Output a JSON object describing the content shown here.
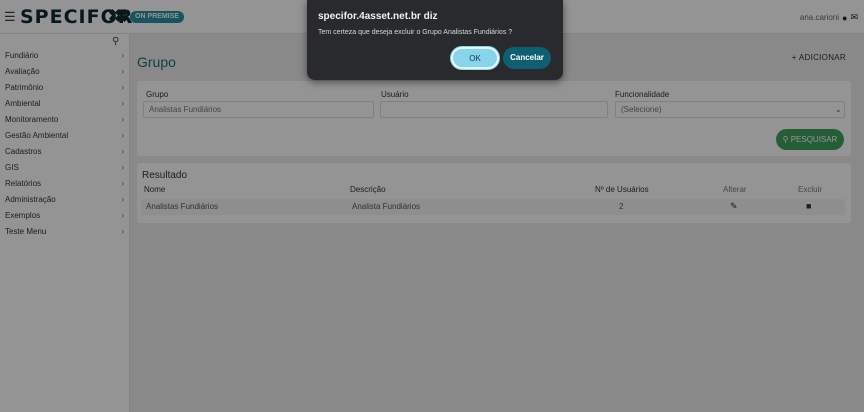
{
  "header": {
    "menu_icon": "hamburger-icon",
    "brand": "SPECIFOR",
    "badge": "ON PREMISE",
    "username": "ana.carioni",
    "user_icon": "user-icon",
    "mail_icon": "mail-icon"
  },
  "sidebar": {
    "search_icon": "search-icon",
    "items": [
      {
        "label": "Fundiário"
      },
      {
        "label": "Avaliação"
      },
      {
        "label": "Patrimônio"
      },
      {
        "label": "Ambiental"
      },
      {
        "label": "Monitoramento"
      },
      {
        "label": "Gestão Ambiental"
      },
      {
        "label": "Cadastros"
      },
      {
        "label": "GIS"
      },
      {
        "label": "Relatórios"
      },
      {
        "label": "Administração"
      },
      {
        "label": "Exemplos"
      },
      {
        "label": "Teste Menu"
      }
    ]
  },
  "page": {
    "title": "Grupo",
    "add_label": "+ ADICIONAR"
  },
  "filters": {
    "grupo_label": "Grupo",
    "grupo_value": "Analistas Fundiários",
    "usuario_label": "Usuário",
    "usuario_value": "",
    "funcionalidade_label": "Funcionalidade",
    "funcionalidade_value": "(Selecione)",
    "search_button": "PESQUISAR"
  },
  "results": {
    "title": "Resultado",
    "columns": {
      "nome": "Nome",
      "descricao": "Descrição",
      "usuarios": "Nº de Usuários",
      "alterar": "Alterar",
      "excluir": "Excluir"
    },
    "rows": [
      {
        "nome": "Analistas Fundiários",
        "descricao": "Analista Fundiários",
        "usuarios": "2"
      }
    ]
  },
  "dialog": {
    "origin": "specifor.4asset.net.br diz",
    "message": "Tem certeza que deseja excluir o Grupo Analistas Fundiários ?",
    "ok_label": "OK",
    "cancel_label": "Cancelar"
  },
  "colors": {
    "brand_dark": "#0d2b33",
    "accent_teal": "#1f6b7d",
    "search_green": "#3fa35e",
    "dialog_bg": "#292a2d",
    "ok_button": "#86d5ea",
    "cancel_button": "#0f5f73"
  }
}
